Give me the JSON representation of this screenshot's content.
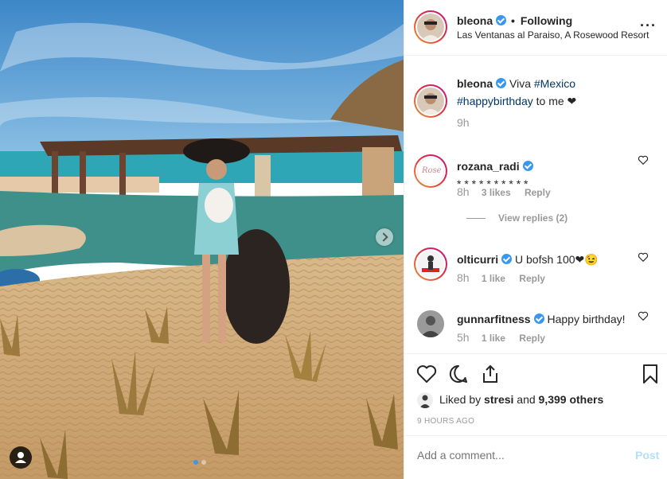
{
  "post": {
    "username": "bleona",
    "follow_label": "Following",
    "separator": "•",
    "location": "Las Ventanas al Paraiso, A Rosewood Resort",
    "more_label": "···"
  },
  "caption": {
    "username": "bleona",
    "text_before": "Viva ",
    "hashtag1": "#Mexico",
    "hashtag2": "#happybirthday",
    "text_after": " to me ❤",
    "time": "9h"
  },
  "comments": [
    {
      "username": "rozana_radi",
      "text": "* * * * * * * * * *",
      "time": "8h",
      "likes": "3 likes",
      "reply": "Reply",
      "avatar_text": "Rose"
    },
    {
      "username": "olticurri",
      "text": "U bofsh 100❤😉",
      "time": "8h",
      "likes": "1 like",
      "reply": "Reply"
    },
    {
      "username": "gunnarfitness",
      "text": "Happy birthday!",
      "time": "5h",
      "likes": "1 like",
      "reply": "Reply"
    }
  ],
  "view_replies": "View replies (2)",
  "liked_by": {
    "prefix": "Liked by ",
    "user": "stresi",
    "middle": " and ",
    "count": "9,399 others"
  },
  "timestamp": "9 HOURS AGO",
  "add_comment_placeholder": "Add a comment...",
  "post_button": "Post",
  "colors": {
    "verified": "#3897f0",
    "link": "#003569",
    "post_button": "#b2dffc",
    "muted": "#999999"
  },
  "icons": [
    "heart-icon",
    "comment-icon",
    "share-icon",
    "bookmark-icon",
    "verified-icon",
    "chevron-right-icon",
    "user-tag-icon"
  ]
}
